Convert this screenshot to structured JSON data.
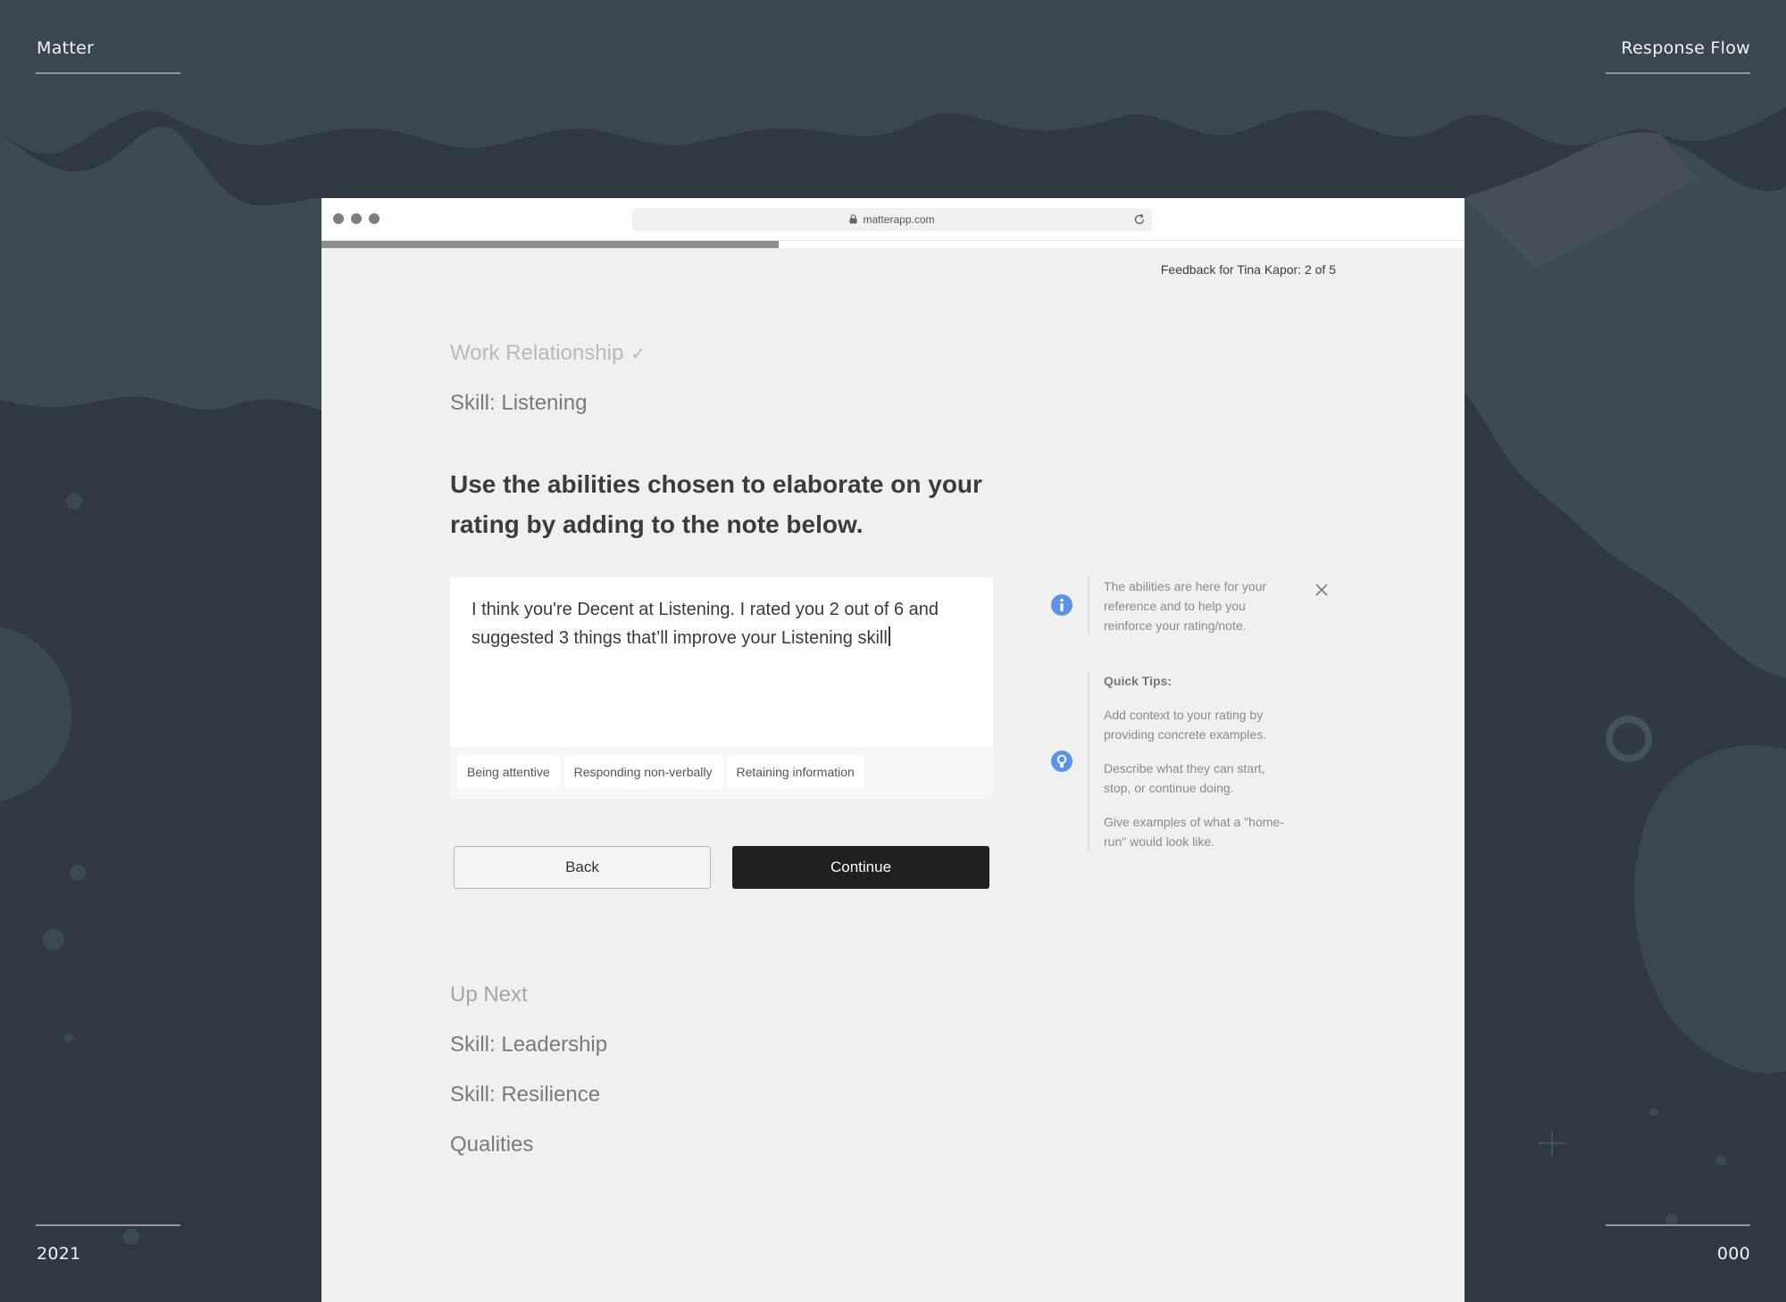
{
  "slide": {
    "brand": "Matter",
    "flow_name": "Response Flow",
    "year": "2021",
    "page_number": "000"
  },
  "browser": {
    "url": "matterapp.com",
    "progress_fraction": 0.4
  },
  "header": {
    "counter": "Feedback for Tina Kapor: 2 of 5"
  },
  "sections": {
    "completed": "Work Relationship",
    "current": "Skill: Listening"
  },
  "prompt": "Use the abilities chosen to elaborate on your rating by adding to the note below.",
  "note": {
    "text": "I think you're Decent at Listening. I rated you 2 out of 6 and suggested 3 things that’ll improve your Listening skill",
    "abilities": [
      "Being attentive",
      "Responding non-verbally",
      "Retaining information"
    ]
  },
  "actions": {
    "back": "Back",
    "continue": "Continue"
  },
  "up_next": {
    "title": "Up Next",
    "items": [
      "Skill: Leadership",
      "Skill: Resilience",
      "Qualities"
    ]
  },
  "sidebar": {
    "info_text": "The abilities are here for your reference and to help you reinforce your rating/note.",
    "tips_title": "Quick Tips:",
    "tips": [
      "Add context to your rating by providing concrete examples.",
      "Describe what they can start, stop, or continue doing.",
      "Give examples of what a \"home-run\" would look like."
    ]
  },
  "colors": {
    "background": "#2f3941",
    "accent_blue": "#5b93e8",
    "primary_button": "#202020"
  }
}
